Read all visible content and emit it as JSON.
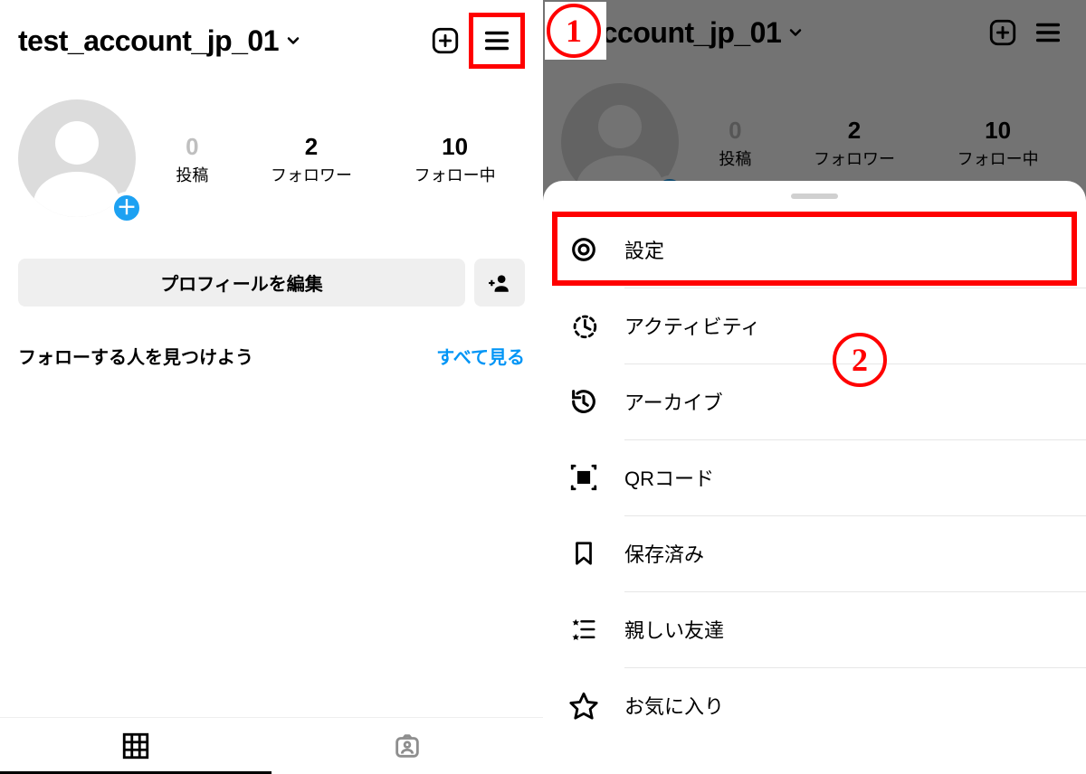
{
  "annotations": {
    "step1": "1",
    "step2": "2"
  },
  "profile": {
    "username": "test_account_jp_01",
    "stats": {
      "posts_count": "0",
      "posts_label": "投稿",
      "followers_count": "2",
      "followers_label": "フォロワー",
      "following_count": "10",
      "following_label": "フォロー中"
    },
    "edit_button": "プロフィールを編集",
    "find_people": "フォローする人を見つけよう",
    "see_all": "すべて見る"
  },
  "right_profile": {
    "username_visible": "t_account_jp_01"
  },
  "menu": {
    "items": [
      {
        "label": "設定"
      },
      {
        "label": "アクティビティ"
      },
      {
        "label": "アーカイブ"
      },
      {
        "label": "QRコード"
      },
      {
        "label": "保存済み"
      },
      {
        "label": "親しい友達"
      },
      {
        "label": "お気に入り"
      }
    ]
  }
}
